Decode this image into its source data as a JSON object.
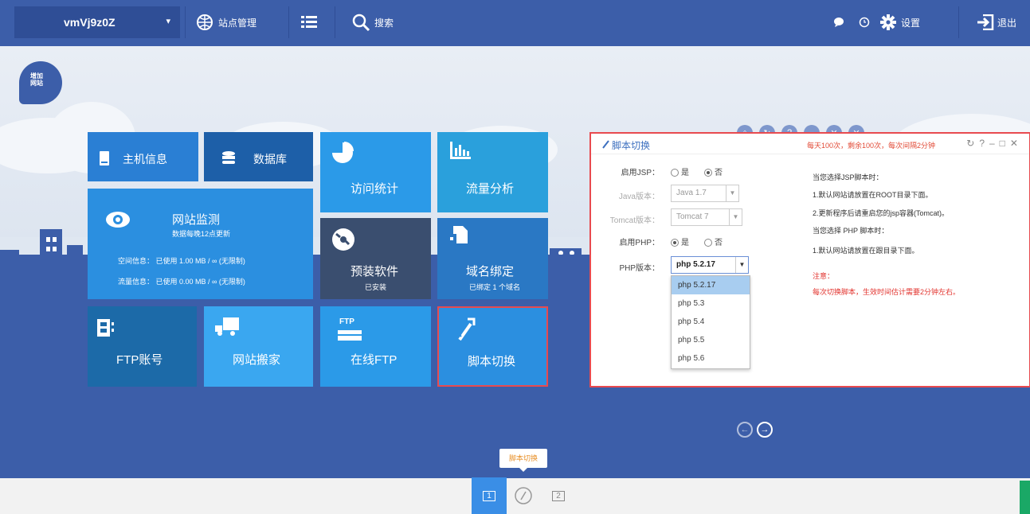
{
  "topbar": {
    "site_name": "vmVj9z0Z",
    "site_caret": "▾",
    "site_manage": "站点管理",
    "search": "搜索",
    "settings": "设置",
    "logout": "退出"
  },
  "add_site": {
    "line1": "增加",
    "line2": "网站"
  },
  "tiles": {
    "host_info": "主机信息",
    "database": "数据库",
    "visit_stats": "访问统计",
    "traffic": "流量分析",
    "monitor": {
      "title": "网站监测",
      "subtitle": "数据每晚12点更新",
      "space": "空间信息： 已使用 1.00 MB / ∞ (无限制)",
      "flow": "流量信息： 已使用 0.00 MB / ∞ (无限制)"
    },
    "preinstall": {
      "title": "预装软件",
      "sub": "已安装"
    },
    "domain": {
      "title": "域名绑定",
      "sub": "已绑定 1 个域名"
    },
    "ftp_account": "FTP账号",
    "migrate": "网站搬家",
    "online_ftp": {
      "title": "在线FTP",
      "tag": "FTP"
    },
    "script_switch": "脚本切换"
  },
  "panel": {
    "title": "脚本切换",
    "notice": "每天100次，剩余100次，每次间隔2分钟",
    "jsp_label": "启用JSP：",
    "yes": "是",
    "no": "否",
    "java_label": "Java版本：",
    "java_value": "Java 1.7",
    "tomcat_label": "Tomcat版本：",
    "tomcat_value": "Tomcat 7",
    "php_enable_label": "启用PHP：",
    "php_label": "PHP版本：",
    "php_value": "php 5.2.17",
    "php_options": [
      "php 5.2.17",
      "php 5.3",
      "php 5.4",
      "php 5.5",
      "php 5.6"
    ],
    "help": [
      "当您选择JSP脚本时：",
      "1.默认网站请放置在ROOT目录下面。",
      "2.更新程序后请重启您的jsp容器(Tomcat)。",
      "当您选择 PHP 脚本时：",
      "1.默认网站请放置在跟目录下面。"
    ],
    "note_title": "注意：",
    "note_text": "每次切换脚本，生效时间估计需要2分钟左右。"
  },
  "tooltip": "脚本切换",
  "bottom": {
    "item1": "1",
    "item3": "2"
  },
  "colors": {
    "accent": "#3c5ea9",
    "highlight": "#e84a4f",
    "tile_blue": "#2b8fe0"
  }
}
